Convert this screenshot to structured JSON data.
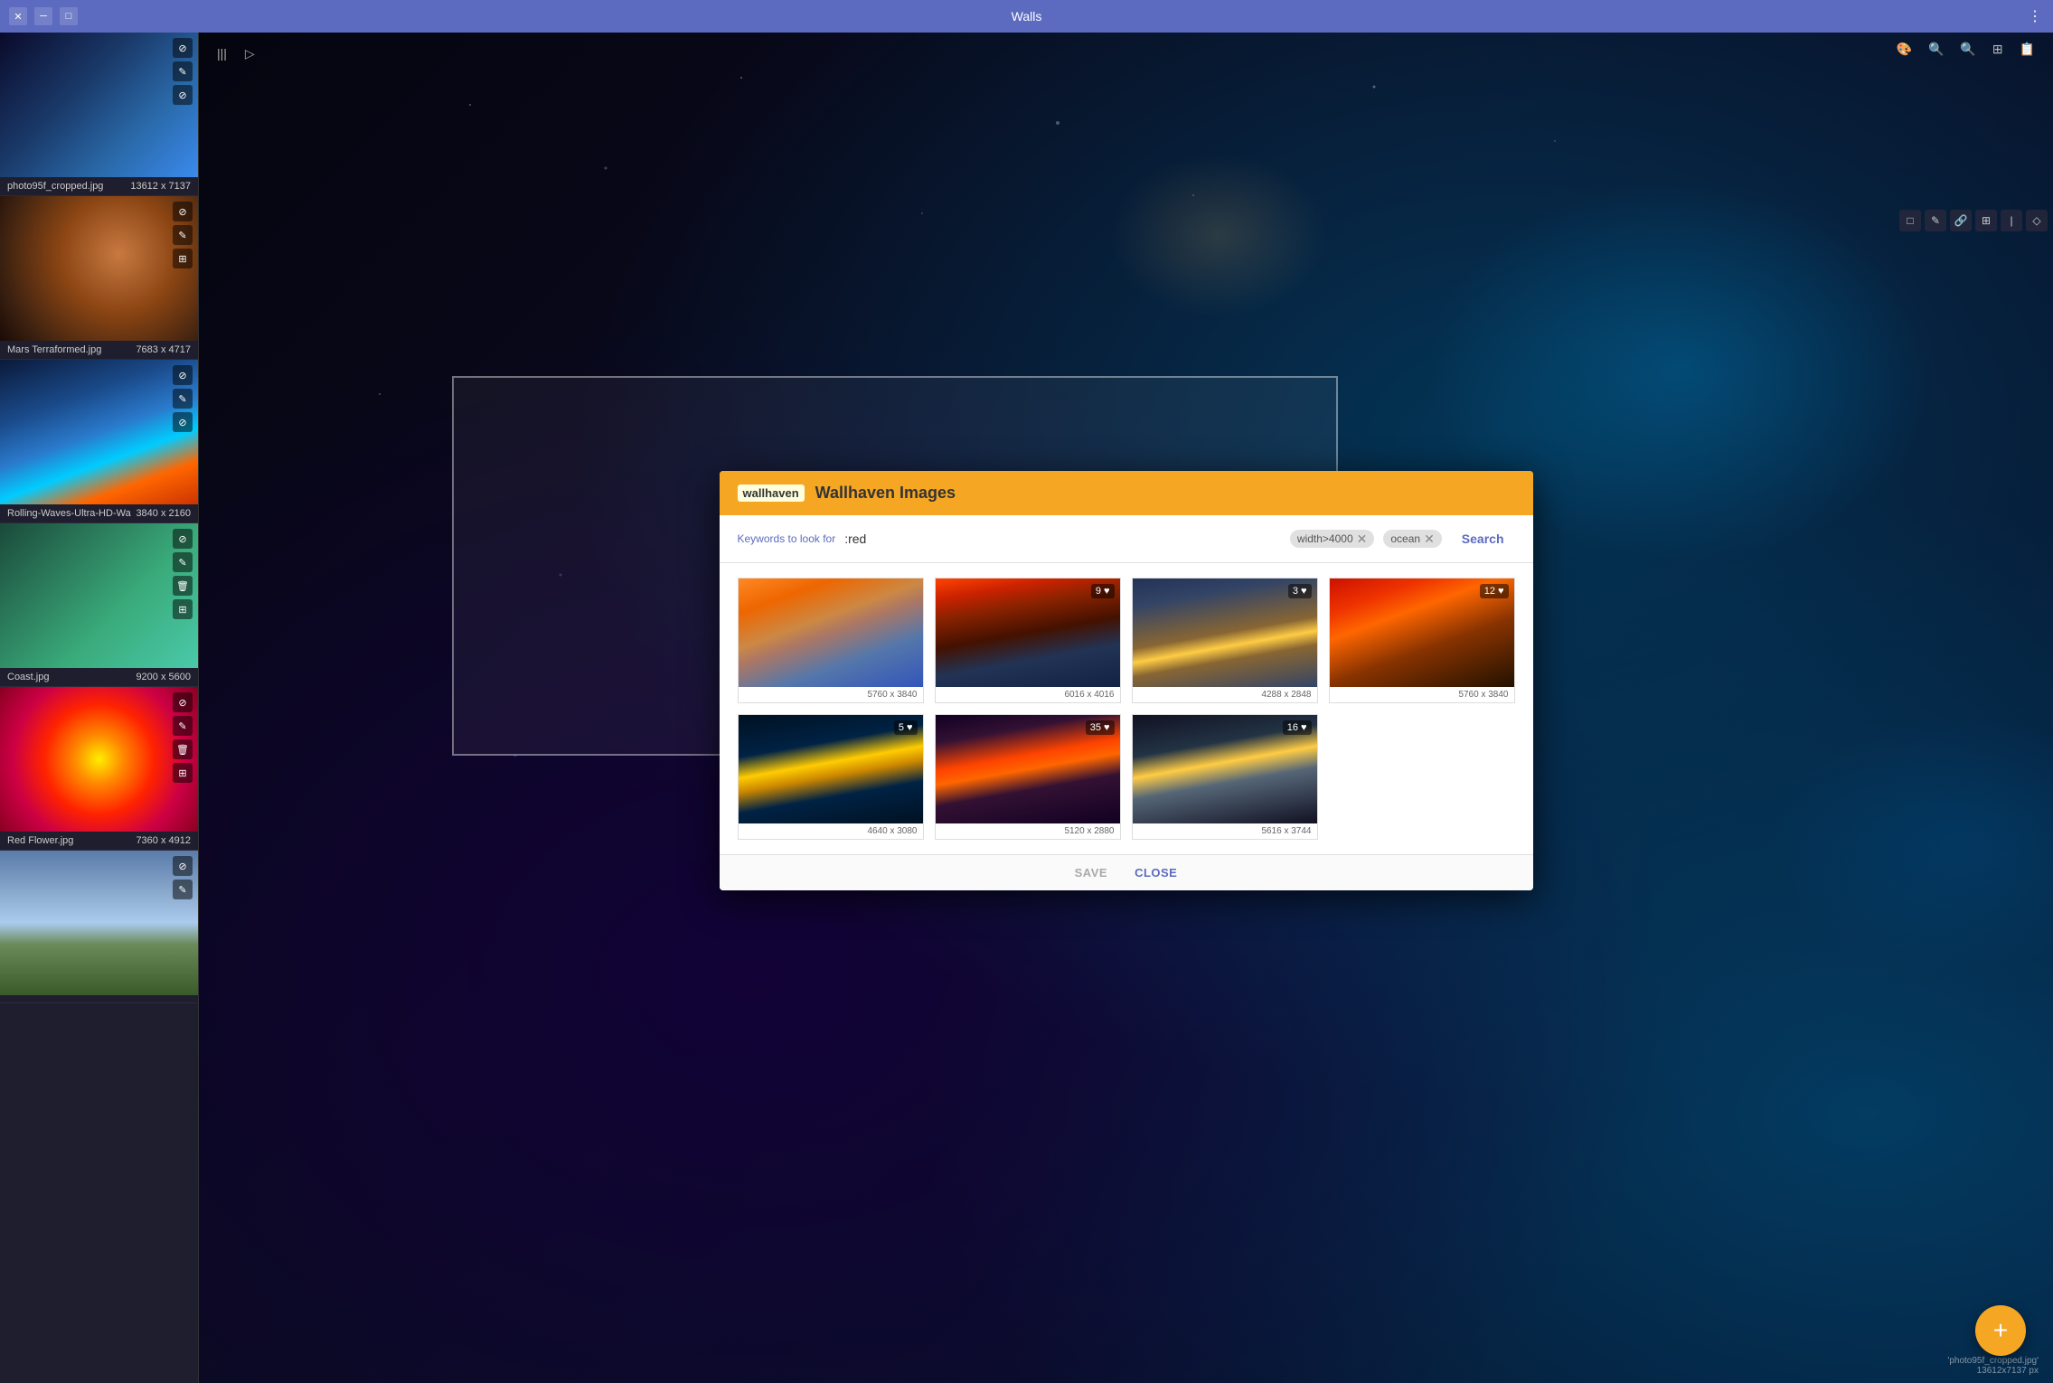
{
  "app": {
    "title": "Walls",
    "titlebar": {
      "minimize_label": "─",
      "maximize_label": "□",
      "menu_icon": "⋮"
    }
  },
  "sidebar": {
    "items": [
      {
        "filename": "photo95f_cropped.jpg",
        "dimensions": "13612 x 7137",
        "thumb_class": "sidebar-thumb-ocean"
      },
      {
        "filename": "Mars Terraformed.jpg",
        "dimensions": "7683 x 4717",
        "thumb_class": "sidebar-thumb-mars"
      },
      {
        "filename": "Rolling-Waves-Ultra-HD-Wa",
        "dimensions": "3840 x 2160",
        "thumb_class": "sidebar-thumb-wave"
      },
      {
        "filename": "Coast.jpg",
        "dimensions": "9200 x 5600",
        "thumb_class": "sidebar-thumb-coast"
      },
      {
        "filename": "Red Flower.jpg",
        "dimensions": "7360 x 4912",
        "thumb_class": "sidebar-thumb-flower"
      },
      {
        "filename": "",
        "dimensions": "",
        "thumb_class": "sidebar-thumb-landscape"
      }
    ],
    "icons": [
      "⊘",
      "✎",
      "🗑",
      "⊞"
    ]
  },
  "toolbar": {
    "left_icons": [
      "|||",
      "▷"
    ],
    "right_icons": [
      "⚙",
      "🔍+",
      "🔍-",
      "⊞",
      "📋"
    ]
  },
  "dialog": {
    "logo_text": "wallhaven",
    "title": "Wallhaven Images",
    "search": {
      "label": "Keywords to look for",
      "value": ":red",
      "tags": [
        {
          "text": "width>4000",
          "removable": true
        },
        {
          "text": "ocean",
          "removable": true
        }
      ],
      "button_label": "Search"
    },
    "grid": {
      "items": [
        {
          "thumb_class": "grid-thumb-beach",
          "dimensions": "5760 x 3840",
          "likes": "",
          "badge": ""
        },
        {
          "thumb_class": "grid-thumb-sunset1",
          "dimensions": "6016 x 4016",
          "likes": "9",
          "badge": "♥"
        },
        {
          "thumb_class": "grid-thumb-reflection",
          "dimensions": "4288 x 2848",
          "likes": "3",
          "badge": "♥"
        },
        {
          "thumb_class": "grid-thumb-redsunset",
          "dimensions": "5760 x 3840",
          "likes": "12",
          "badge": "♥"
        },
        {
          "thumb_class": "grid-thumb-moonrise",
          "dimensions": "4640 x 3080",
          "likes": "5",
          "badge": "♥"
        },
        {
          "thumb_class": "grid-thumb-redsea",
          "dimensions": "5120 x 2880",
          "likes": "35",
          "badge": "♥"
        },
        {
          "thumb_class": "grid-thumb-bridge",
          "dimensions": "5616 x 3744",
          "likes": "16",
          "badge": "♥"
        }
      ]
    },
    "footer": {
      "save_label": "SAVE",
      "close_label": "CLOSE"
    }
  },
  "watermark": {
    "filename": "'photo95f_cropped.jpg'",
    "dimensions": "13612x7137 px"
  },
  "fab": {
    "icon": "+"
  },
  "action_icons": [
    "□",
    "✎",
    "✎",
    "⊞",
    "|",
    "◇"
  ]
}
